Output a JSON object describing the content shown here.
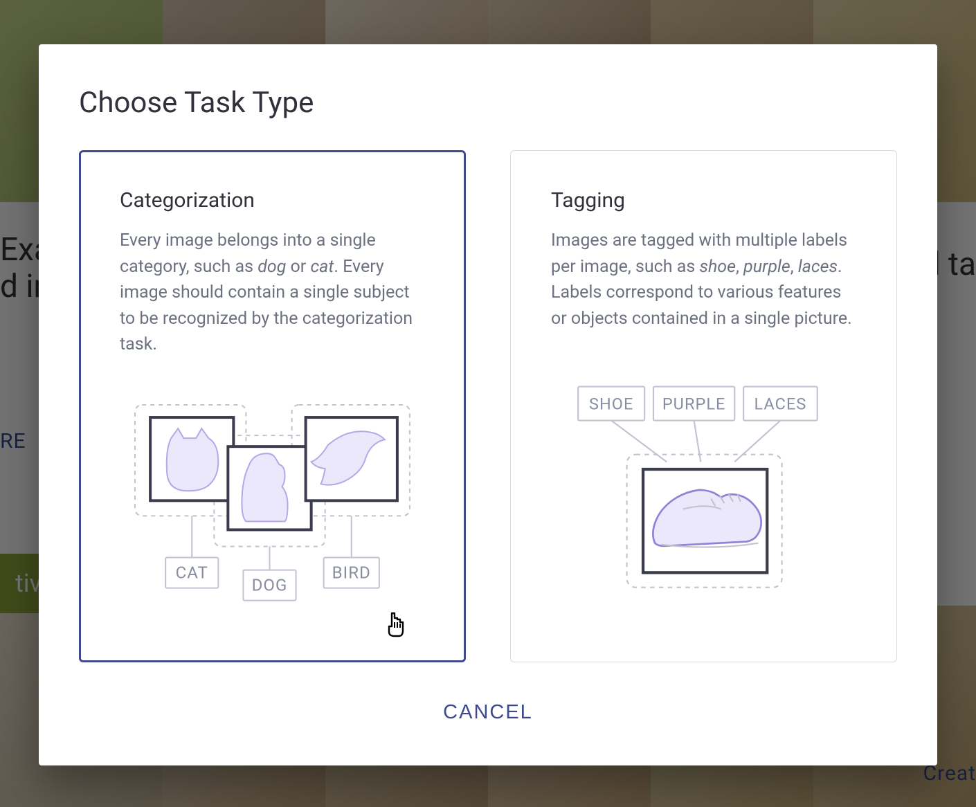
{
  "background": {
    "text_top_left": "Exa\nd in",
    "text_top_right": "d ta",
    "link_left": "RE",
    "chip_left": "tive",
    "link_bottom_right": "Creat"
  },
  "modal": {
    "title": "Choose Task Type",
    "cards": {
      "categorization": {
        "title": "Categorization",
        "desc_pre1": "Every image belongs into a single category, such as ",
        "desc_em1": "dog",
        "desc_mid1": " or ",
        "desc_em2": "cat",
        "desc_post1": ". Every image should contain a single subject to be recognized by the categorization task.",
        "labels": {
          "cat": "CAT",
          "dog": "DOG",
          "bird": "BIRD"
        }
      },
      "tagging": {
        "title": "Tagging",
        "desc_pre1": "Images are tagged with multiple labels per image, such as ",
        "desc_em1": "shoe",
        "desc_mid1": ", ",
        "desc_em2": "purple",
        "desc_mid2": ", ",
        "desc_em3": "laces",
        "desc_post1": ". Labels correspond to various features or objects contained in a single picture.",
        "labels": {
          "shoe": "SHOE",
          "purple": "PURPLE",
          "laces": "LACES"
        }
      }
    },
    "cancel_label": "CANCEL"
  }
}
